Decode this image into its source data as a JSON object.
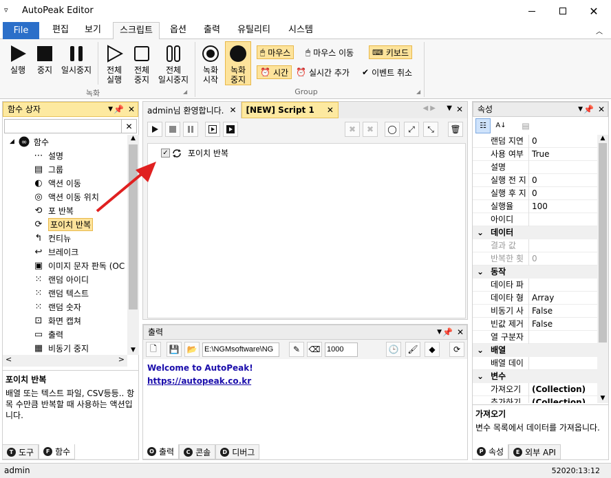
{
  "app": {
    "title": "AutoPeak Editor",
    "status_user": "admin",
    "status_time": "52020:13:12"
  },
  "ribbon_tabs": [
    "File",
    "편집",
    "보기",
    "스크립트",
    "옵션",
    "출력",
    "유틸리티",
    "시스템"
  ],
  "ribbon": {
    "run": "실행",
    "stop": "중지",
    "pause": "일시중지",
    "run_all_1": "전체",
    "run_all_2": "실행",
    "stop_all_1": "전체",
    "stop_all_2": "중지",
    "pause_all_1": "전체",
    "pause_all_2": "일시중지",
    "group_record": "녹화",
    "rec_start_1": "녹화",
    "rec_start_2": "시작",
    "rec_stop_1": "녹화",
    "rec_stop_2": "중지",
    "mouse": "마우스",
    "mouse_move": "마우스 이동",
    "keyboard": "키보드",
    "time": "시간",
    "realtime_add": "실시간 추가",
    "event_cancel": "이벤트 취소",
    "group_group": "Group"
  },
  "function_box": {
    "title": "함수 상자",
    "root": "함수",
    "items": [
      "설명",
      "그룹",
      "액션 이동",
      "액션 이동 위치",
      "포 반복",
      "포이치 반복",
      "컨티뉴",
      "브레이크",
      "이미지 문자 판독 (OC",
      "랜덤 아이디",
      "랜덤 텍스트",
      "랜덤 숫자",
      "화면 캡쳐",
      "출력",
      "비동기 중지"
    ],
    "desc_title": "포이치 반복",
    "desc_text": "배열 또는 텍스트 파일, CSV등등.. 항목 수만큼 반복할 때 사용하는 액션입니다.",
    "tab_tools": "도구",
    "tab_functions": "함수"
  },
  "editor": {
    "tab_welcome": "admin님 환영합니다.",
    "tab_script": "[NEW] Script 1",
    "script_line": "포이치 반복"
  },
  "output": {
    "title": "출력",
    "path": "E:\\NGMsoftware\\NG",
    "interval": "1000",
    "welcome": "Welcome to AutoPeak!",
    "link": "https://autopeak.co.kr",
    "tab_output": "출력",
    "tab_console": "콘솔",
    "tab_debug": "디버그"
  },
  "properties": {
    "title": "속성",
    "rows_top": [
      {
        "k": "랜덤 지연",
        "v": "0"
      },
      {
        "k": "사용 여부",
        "v": "True"
      },
      {
        "k": "설명",
        "v": ""
      },
      {
        "k": "실행 전 지",
        "v": "0"
      },
      {
        "k": "실행 후 지",
        "v": "0"
      },
      {
        "k": "실행율",
        "v": "100"
      },
      {
        "k": "아이디",
        "v": ""
      }
    ],
    "cat_data": "데이터",
    "rows_data": [
      {
        "k": "결과 값",
        "v": ""
      },
      {
        "k": "반복한 횟",
        "v": "0"
      }
    ],
    "cat_action": "동작",
    "rows_action": [
      {
        "k": "데이타 파",
        "v": ""
      },
      {
        "k": "데이타 형",
        "v": "Array"
      },
      {
        "k": "비동기 사",
        "v": "False"
      },
      {
        "k": "빈값 제거",
        "v": "False"
      },
      {
        "k": "열 구분자",
        "v": ""
      }
    ],
    "cat_array": "배열",
    "rows_array": [
      {
        "k": "배열 데이",
        "v": ""
      }
    ],
    "cat_var": "변수",
    "rows_var": [
      {
        "k": "가져오기",
        "v": "(Collection)"
      },
      {
        "k": "추가하기",
        "v": "(Collection)"
      }
    ],
    "desc_title": "가져오기",
    "desc_text": "변수 목록에서 데이터를 가져옵니다.",
    "tab_props": "속성",
    "tab_api": "외부 API"
  },
  "colors": {
    "file_tab": "#2b6fc9",
    "highlight": "#fde39b",
    "panel_title": "#fde9a0",
    "arrow": "#e02020",
    "link": "#1a0dab"
  }
}
